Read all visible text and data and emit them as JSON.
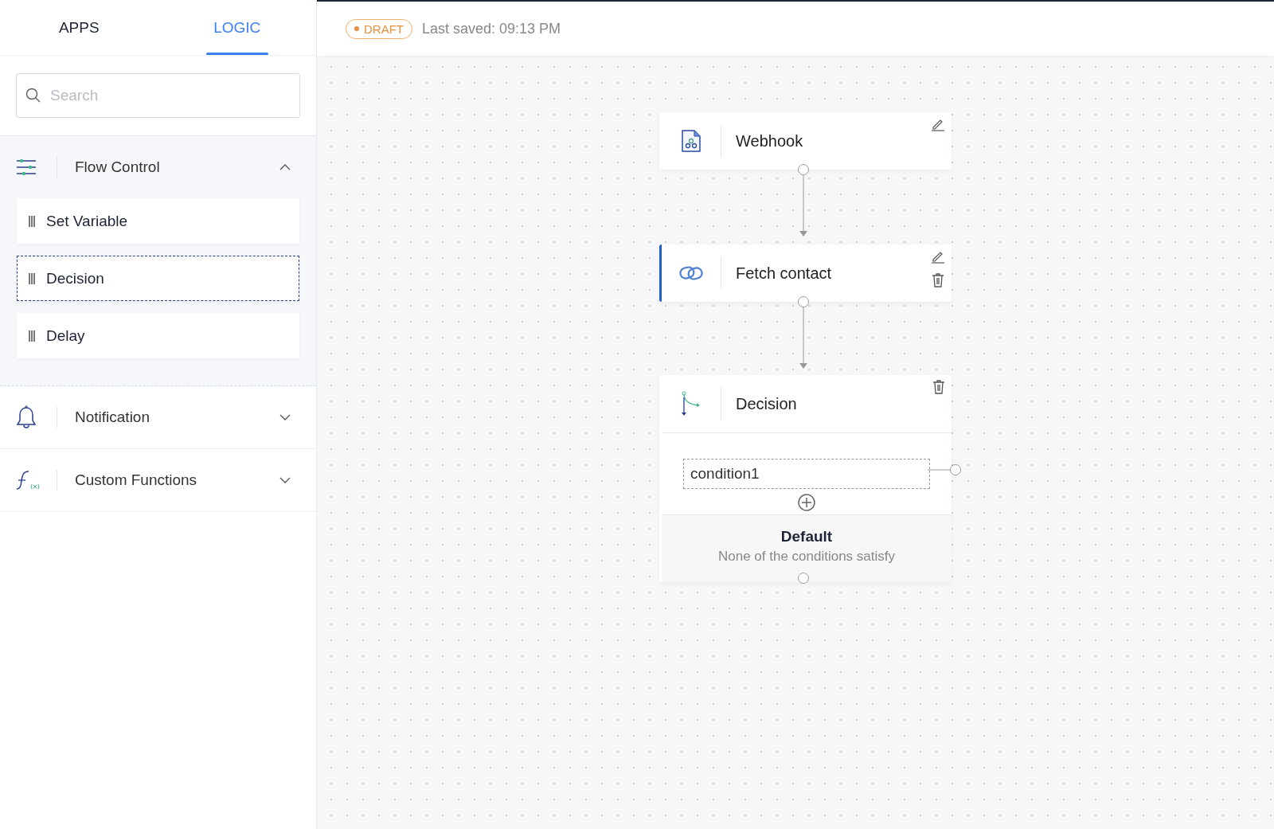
{
  "tabs": [
    {
      "label": "APPS",
      "selected": false
    },
    {
      "label": "LOGIC",
      "selected": true
    }
  ],
  "header": {
    "status": "DRAFT",
    "last_saved": "Last saved: 09:13 PM"
  },
  "search": {
    "placeholder": "Search"
  },
  "sidebar": {
    "groups": [
      {
        "kind": "flow",
        "label": "Flow Control",
        "expanded": true,
        "items": [
          {
            "label": "Set Variable",
            "selected": false
          },
          {
            "label": "Decision",
            "selected": true
          },
          {
            "label": "Delay",
            "selected": false
          }
        ]
      },
      {
        "kind": "notification",
        "label": "Notification",
        "expanded": false
      },
      {
        "kind": "function",
        "label": "Custom Functions",
        "expanded": false
      }
    ]
  },
  "flow": {
    "nodes": [
      {
        "kind": "trigger",
        "title": "Webhook",
        "selected": false,
        "editable": true,
        "deletable": false
      },
      {
        "kind": "action",
        "title": "Fetch contact",
        "selected": true,
        "editable": true,
        "deletable": true
      },
      {
        "kind": "decision",
        "title": "Decision",
        "selected": false,
        "editable": false,
        "deletable": true,
        "conditions": [
          "condition1"
        ],
        "default": {
          "title": "Default",
          "subtitle": "None of the conditions satisfy"
        }
      }
    ]
  }
}
